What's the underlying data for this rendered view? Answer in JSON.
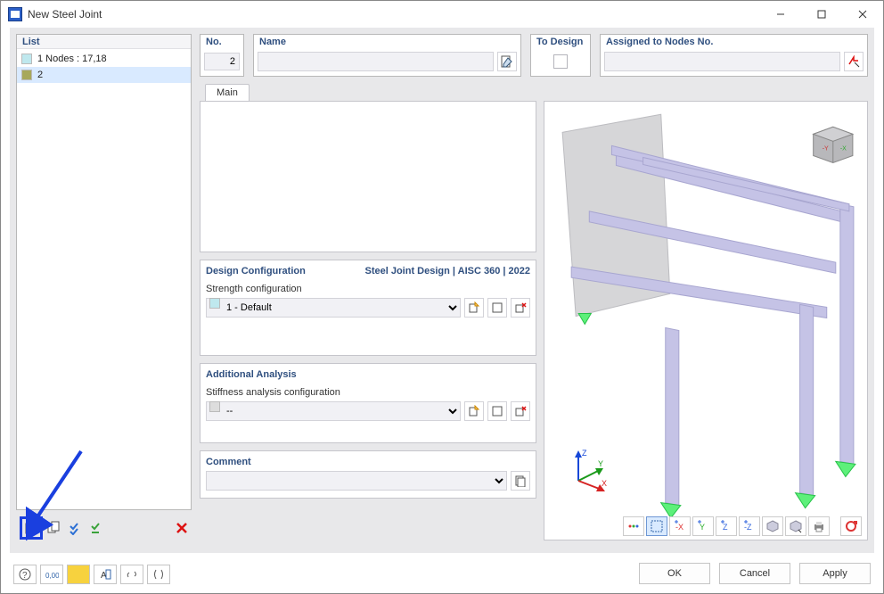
{
  "window": {
    "title": "New Steel Joint"
  },
  "list": {
    "header": "List",
    "items": [
      {
        "swatch": "#bfe8ee",
        "label": "1 Nodes : 17,18",
        "selected": false
      },
      {
        "swatch": "#a7a85b",
        "label": "2",
        "selected": true
      }
    ]
  },
  "list_toolbar": {
    "new_icon": "new-item-icon",
    "copy_icon": "copy-item-icon",
    "check1_icon": "check-blue-icon",
    "check2_icon": "check-green-icon",
    "delete_icon": "delete-icon"
  },
  "fields": {
    "no_label": "No.",
    "no_value": "2",
    "name_label": "Name",
    "name_value": "",
    "todesign_label": "To Design",
    "assigned_label": "Assigned to Nodes No.",
    "assigned_value": ""
  },
  "tabs": {
    "main": "Main"
  },
  "design_config": {
    "title": "Design Configuration",
    "standard": "Steel Joint Design | AISC 360 | 2022",
    "subtitle": "Strength configuration",
    "value": "1 - Default",
    "swatch": "#bfe8ee"
  },
  "additional": {
    "title": "Additional Analysis",
    "subtitle": "Stiffness analysis configuration",
    "value": "--"
  },
  "comment": {
    "title": "Comment",
    "value": ""
  },
  "dialog": {
    "ok": "OK",
    "cancel": "Cancel",
    "apply": "Apply"
  }
}
